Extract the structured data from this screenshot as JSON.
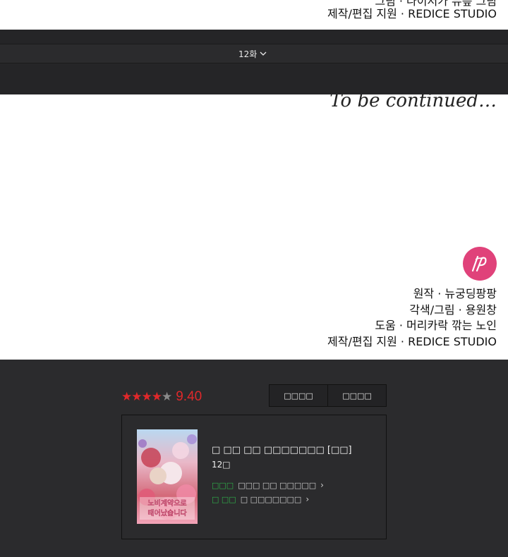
{
  "top_credits": {
    "cut_line": "그림 · 나이저가 뮤릎 그림",
    "studio": "제작/편집 지원 · REDICE STUDIO"
  },
  "episode_nav": {
    "current_episode": "12화"
  },
  "comic_end": {
    "continued_text": "To be continued…",
    "credits": [
      "원작 · 뉴궁딩팡팡",
      "각색/그림 · 용원창",
      "도움 · 머리카락 깎는 노인",
      "제작/편집 지원 · REDICE STUDIO"
    ]
  },
  "rating": {
    "stars": "★★★★",
    "half_star": "★",
    "score": "9.40"
  },
  "actions": {
    "btn1": "□□□□",
    "btn2": "□□□□"
  },
  "series": {
    "title": "□ □□ □□ □□□□□□□ [□□]",
    "episode": "12□",
    "link1_tag": "□□□",
    "link1_text": "□□□ □□ □□□□□",
    "link2_tag": "□ □□",
    "link2_text": "□ □□□□□□□",
    "cover_text": "노비계약으로 태어났습니다"
  },
  "colors": {
    "accent_red": "#e0282a",
    "accent_green": "#2fb24a",
    "logo_pink": "#e0427a"
  }
}
